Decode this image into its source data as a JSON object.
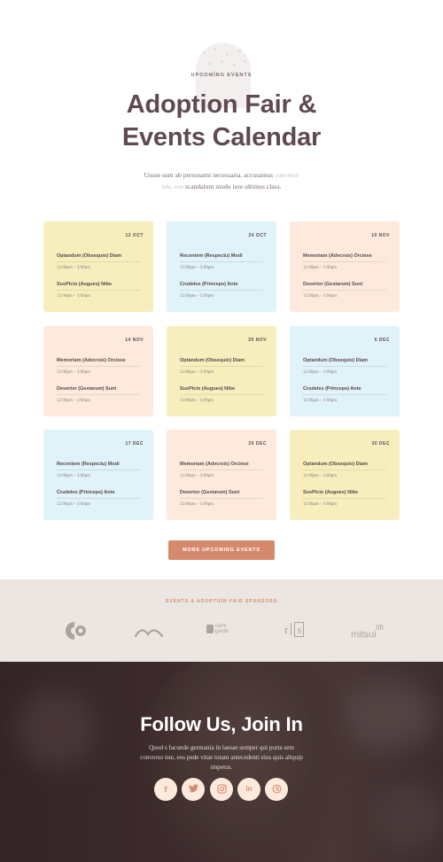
{
  "hero": {
    "eyebrow": "UPCOMING EVENTS",
    "title_line1": "Adoption Fair &",
    "title_line2": "Events Calendar",
    "desc_a": "Ususe sum ab personami necessaria, accusamus",
    "desc_b": "converso",
    "desc_c": "iste, eos",
    "desc_d": "scandalum modo iure ultimus class."
  },
  "cards": [
    {
      "date": "12 OCT",
      "color": "yellow",
      "events": [
        {
          "title": "Optandum (Obsequio) Diam",
          "time": "12:00pm – 3:00pm"
        },
        {
          "title": "SusPicio (Augues) Nibe",
          "time": "12:00pm – 3:00pm"
        }
      ]
    },
    {
      "date": "24 OCT",
      "color": "blue",
      "events": [
        {
          "title": "Recentem (Respectu) Modi",
          "time": "12:00pm – 3:00pm"
        },
        {
          "title": "Crudeles (Princeps) Ante",
          "time": "12:00pm – 3:00pm"
        }
      ]
    },
    {
      "date": "10 NOV",
      "color": "peach",
      "events": [
        {
          "title": "Memoriam (Advcrsis) Orciese",
          "time": "12:00pm – 3:00pm"
        },
        {
          "title": "Desertor (Gestarum) Sunt",
          "time": "12:00pm – 3:00pm"
        }
      ]
    },
    {
      "date": "14 NOV",
      "color": "peach",
      "events": [
        {
          "title": "Memoriam (Advcrsis) Orciese",
          "time": "12:00pm – 3:00pm"
        },
        {
          "title": "Desertor (Gestarum) Sunt",
          "time": "12:00pm – 3:00pm"
        }
      ]
    },
    {
      "date": "20 NOV",
      "color": "yellow",
      "events": [
        {
          "title": "Optandum (Obsequio) Diam",
          "time": "12:00pm – 3:00pm"
        },
        {
          "title": "SusPicio (Augues) Nibe",
          "time": "12:00pm – 3:00pm"
        }
      ]
    },
    {
      "date": "6 DEC",
      "color": "blue",
      "events": [
        {
          "title": "Optandum (Obsequio) Diam",
          "time": "12:00pm – 3:00pm"
        },
        {
          "title": "Crudeles (Princeps) Ante",
          "time": "12:00pm – 3:00pm"
        }
      ]
    },
    {
      "date": "17 DEC",
      "color": "blue",
      "events": [
        {
          "title": "Recentem (Respectu) Modi",
          "time": "12:00pm – 3:00pm"
        },
        {
          "title": "Crudeles (Princeps) Ante",
          "time": "12:00pm – 3:00pm"
        }
      ]
    },
    {
      "date": "25 DEC",
      "color": "peach",
      "events": [
        {
          "title": "Memoriam (Advcrsis) Orciese",
          "time": "12:00pm – 3:00pm"
        },
        {
          "title": "Desertor (Gestarum) Sunt",
          "time": "12:00pm – 3:00pm"
        }
      ]
    },
    {
      "date": "30 DEC",
      "color": "yellow",
      "events": [
        {
          "title": "Optandum (Obsequio) Diam",
          "time": "12:00pm – 3:00pm"
        },
        {
          "title": "SusPicio (Augues) Nibe",
          "time": "12:00pm – 3:00pm"
        }
      ]
    }
  ],
  "cta_label": "MORE UPCOMING EVENTS",
  "sponsors": {
    "title": "EVENTS & ADOPTION FAIR SPONSORS",
    "logos": [
      {
        "icon": "c-circle-logo",
        "text": ""
      },
      {
        "icon": "wave-logo",
        "text": ""
      },
      {
        "icon": "cami-garde-logo",
        "text_a": "cami",
        "text_b": "garde"
      },
      {
        "icon": "rs-logo",
        "text_a": "r",
        "text_b": "s"
      },
      {
        "icon": "mitsui-lift-logo",
        "text_a": "mitsui",
        "text_b": "lift"
      }
    ]
  },
  "follow": {
    "title": "Follow Us, Join In",
    "desc": "Quod s facunde germania in laesae semper qui porta sem converso iste, eos pede vitae totam antecedenti eius quis aliquip impetus.",
    "socials": [
      {
        "icon": "facebook-icon",
        "glyph": "f"
      },
      {
        "icon": "twitter-icon",
        "glyph": ""
      },
      {
        "icon": "instagram-icon",
        "glyph": ""
      },
      {
        "icon": "linkedin-icon",
        "glyph": "in"
      },
      {
        "icon": "skype-icon",
        "glyph": ""
      }
    ]
  },
  "colors": {
    "accent": "#d58a6d",
    "heading": "#5f4a4f",
    "card_yellow": "#f6efbd",
    "card_blue": "#dff3f8",
    "card_peach": "#fdeadd",
    "sponsor_band": "#ebe6e1"
  }
}
